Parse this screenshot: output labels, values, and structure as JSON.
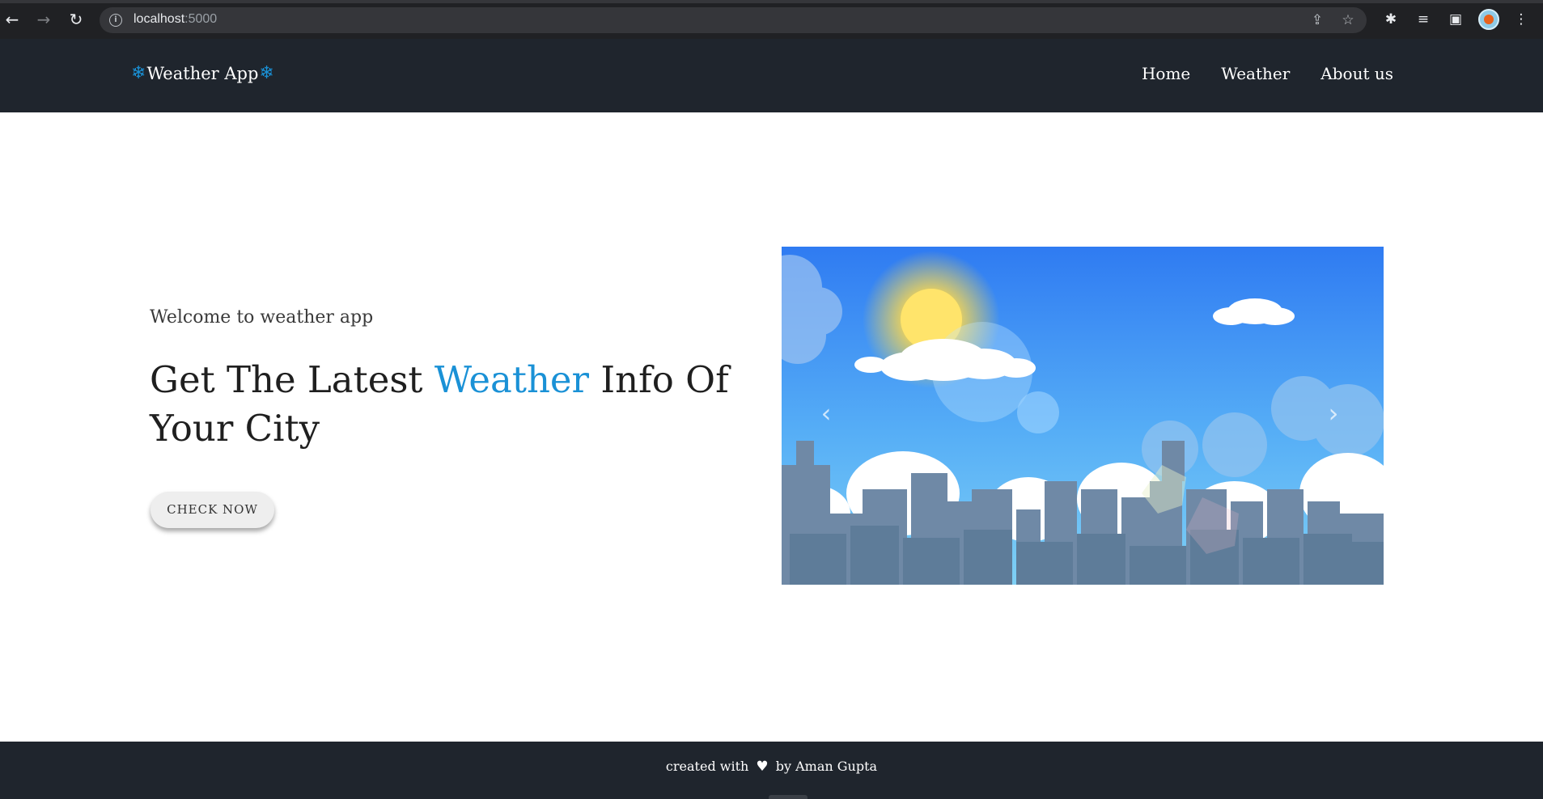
{
  "browser": {
    "url_host": "localhost",
    "url_port": ":5000",
    "icons": {
      "back": "back-arrow-icon",
      "forward": "forward-arrow-icon",
      "reload": "reload-icon",
      "site_info": "info-icon",
      "share": "share-icon",
      "bookmark": "star-icon",
      "extensions": "puzzle-icon",
      "reading_list": "reading-list-icon",
      "side_panel": "side-panel-icon",
      "menu": "kebab-menu-icon"
    }
  },
  "navbar": {
    "brand": "Weather App",
    "links": [
      "Home",
      "Weather",
      "About us"
    ]
  },
  "hero": {
    "welcome": "Welcome to weather app",
    "headline_before": "Get The Latest ",
    "headline_accent": "Weather",
    "headline_after": " Info Of Your City",
    "cta": "CHECK NOW"
  },
  "carousel": {
    "prev": "‹",
    "next": "›"
  },
  "footer": {
    "prefix": "created with",
    "suffix": "by Aman Gupta"
  },
  "colors": {
    "navbar_bg": "#1f252d",
    "accent": "#1a91d6",
    "sky_top": "#2f7bf2",
    "sky_bottom": "#6ac1f5",
    "city": "#5e7c99"
  }
}
